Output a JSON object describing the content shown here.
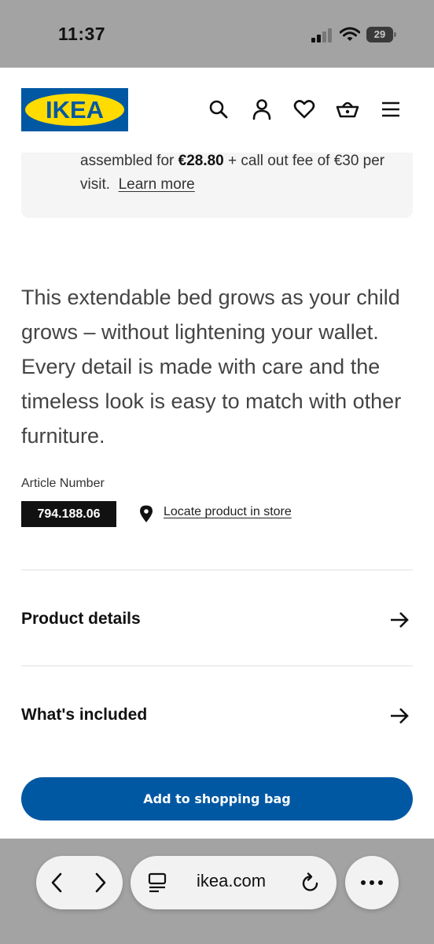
{
  "status_bar": {
    "time": "11:37",
    "battery": "29"
  },
  "header": {
    "logo_text": "IKEA",
    "icons": [
      "search-icon",
      "account-icon",
      "heart-icon",
      "basket-icon",
      "menu-icon"
    ]
  },
  "assembly": {
    "text_before": "assembled for ",
    "price": "€28.80",
    "text_after": " + call out fee of €30 per visit.",
    "link": "Learn more"
  },
  "description": "This extendable bed grows as your child grows – without lightening your wallet. Every detail is made with care and the timeless look is easy to match with other furniture.",
  "article": {
    "label": "Article Number",
    "number": "794.188.06",
    "locate_link": "Locate product in store"
  },
  "sections": [
    {
      "label": "Product details"
    },
    {
      "label": "What's included"
    }
  ],
  "cta_label": "Add to shopping bag",
  "browser": {
    "url": "ikea.com"
  },
  "colors": {
    "brand_blue": "#0058a3",
    "brand_yellow": "#ffdb00"
  }
}
